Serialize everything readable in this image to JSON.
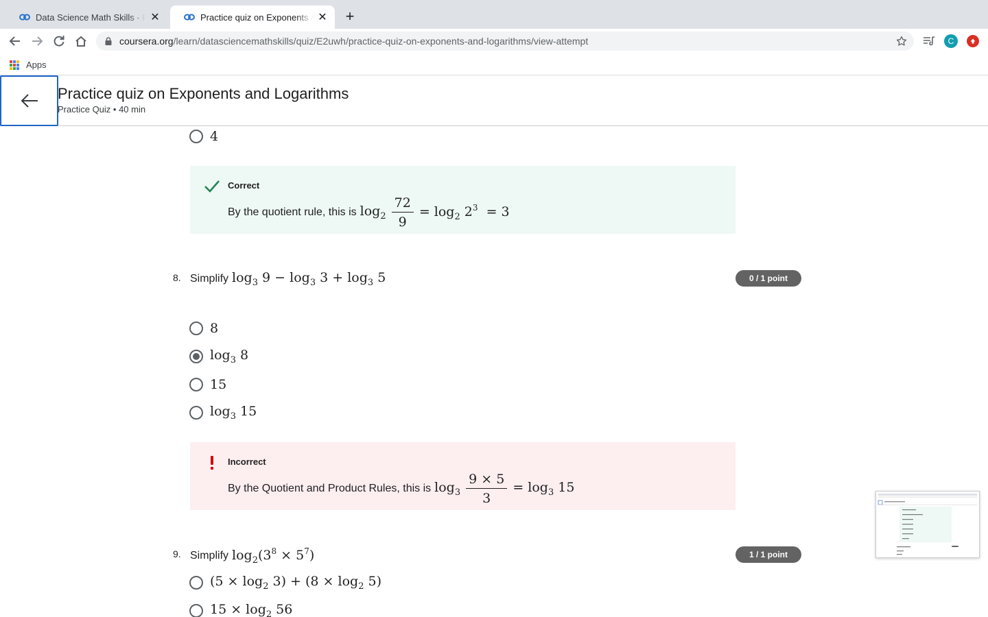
{
  "browser": {
    "tabs": [
      {
        "title": "Data Science Math Skills - Fundamentals",
        "active": false
      },
      {
        "title": "Practice quiz on Exponents and Logarithms",
        "active": true
      }
    ],
    "url_host": "coursera.org",
    "url_path": "/learn/datasciencemathskills/quiz/E2uwh/practice-quiz-on-exponents-and-logarithms/view-attempt",
    "bookmark_apps": "Apps",
    "profile_initial": "C"
  },
  "quiz": {
    "title": "Practice quiz on Exponents and Logarithms",
    "subtitle": "Practice Quiz • 40 min"
  },
  "prev_question": {
    "last_option": "4",
    "feedback": {
      "status": "Correct",
      "lead": "By the quotient rule, this is",
      "log": "log",
      "log_base": "2",
      "frac_num": "72",
      "frac_den": "9",
      "rest1": "= log",
      "rest1_base": "2",
      "rest2": "2",
      "rest2_exp": "3",
      "rest3": "= 3"
    }
  },
  "q8": {
    "number": "8.",
    "prompt": "Simplify",
    "expr": {
      "log": "log",
      "base": "3"
    },
    "expr_parts": [
      "9 − ",
      "3 + ",
      "5"
    ],
    "score": "0 / 1 point",
    "options": [
      {
        "text": "8",
        "selected": false
      },
      {
        "log": "log",
        "base": "3",
        "text": "8",
        "selected": true
      },
      {
        "text": "15",
        "selected": false
      },
      {
        "log": "log",
        "base": "3",
        "text": "15",
        "selected": false
      }
    ],
    "feedback": {
      "status": "Incorrect",
      "lead": "By the Quotient and Product Rules, this is",
      "log": "log",
      "log_base": "3",
      "frac_num": "9 × 5",
      "frac_den": "3",
      "rest": "= log",
      "rest_base": "3",
      "rest_val": "15"
    }
  },
  "q9": {
    "number": "9.",
    "prompt": "Simplify",
    "log": "log",
    "base": "2",
    "e1": "3",
    "e1_exp": "8",
    "e2": "5",
    "e2_exp": "7",
    "score": "1 / 1 point",
    "options": [
      {
        "a": "(5 × log",
        "a_base": "2",
        "a_rest": " 3) + (8 × log",
        "b_base": "2",
        "b_rest": " 5)"
      },
      {
        "a": "15 × log",
        "a_base": "2",
        "a_rest": " 56"
      }
    ]
  },
  "colors": {
    "correct_bg": "#eef8f4",
    "incorrect_bg": "#fdeef0",
    "correct_icon": "#1f8354",
    "incorrect_icon": "#d30001",
    "accent": "#1f65c8",
    "pill": "#636363"
  }
}
